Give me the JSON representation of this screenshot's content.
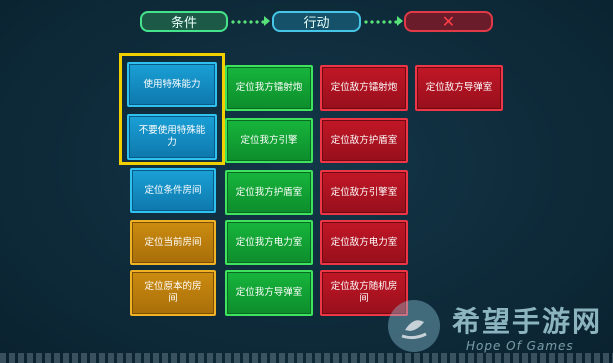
{
  "tabs": {
    "condition": "条件",
    "action": "行动",
    "close": "✕"
  },
  "columns": {
    "blue": [
      {
        "label": "使用特殊能力",
        "selected": true
      },
      {
        "label": "不要使用特殊能力",
        "selected": true
      },
      {
        "label": "定位条件房间"
      }
    ],
    "orange": [
      {
        "label": "定位当前房间"
      },
      {
        "label": "定位原本的房间"
      }
    ],
    "green": [
      {
        "label": "定位我方镭射炮"
      },
      {
        "label": "定位我方引擎"
      },
      {
        "label": "定位我方护盾室"
      },
      {
        "label": "定位我方电力室"
      },
      {
        "label": "定位我方导弹室"
      }
    ],
    "red": [
      {
        "label": "定位敌方镭射炮"
      },
      {
        "label": "定位敌方护盾室"
      },
      {
        "label": "定位敌方引擎室"
      },
      {
        "label": "定位敌方电力室"
      },
      {
        "label": "定位敌方随机房间"
      }
    ],
    "red_extra": [
      {
        "label": "定位敌方导弹室"
      }
    ]
  },
  "watermark": {
    "title": "希望手游网",
    "subtitle": "Hope Of Games"
  },
  "colors": {
    "background": "#0e2a39",
    "blue": "#1aa0d6",
    "green": "#17b53c",
    "red": "#c21726",
    "orange": "#cc8c10",
    "selection": "#f2d000"
  }
}
